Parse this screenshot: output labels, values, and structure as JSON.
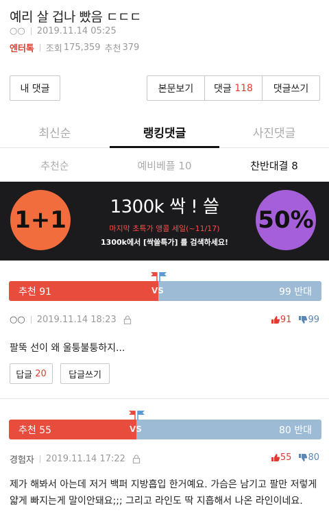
{
  "post": {
    "title": "예리 살 겁나 빴음 ㄷㄷㄷ",
    "author": "○○",
    "datetime": "2019.11.14 05:25",
    "category": "엔터톡",
    "views_label": "조회",
    "views": "175,359",
    "recommend_label": "추천",
    "recommend": "379"
  },
  "buttons": {
    "my_comments": "내 댓글",
    "view_body": "본문보기",
    "comments_label": "댓글",
    "comments_count": "118",
    "write_comment": "댓글쓰기"
  },
  "tabs": [
    {
      "label": "최신순"
    },
    {
      "label": "랭킹댓글"
    },
    {
      "label": "사진댓글"
    }
  ],
  "subtabs": [
    {
      "label": "추천순"
    },
    {
      "label": "예비베플 10"
    },
    {
      "label": "찬반대결 8"
    }
  ],
  "ad": {
    "left_badge": "1+1",
    "headline": "1300k 싹 ! 쓸",
    "sub1": "마지막 초특가 앵콜 세일(~11/17)",
    "sub2": "1300k에서 [싹쓸특가] 를 검색하세요!",
    "right_badge": "50%"
  },
  "comments": [
    {
      "vote_up_text": "추천 91",
      "vote_down_text": "99 반대",
      "vs": "VS",
      "up_ratio": 0.479,
      "author": "○○",
      "datetime": "2019.11.14 18:23",
      "likes": "91",
      "dislikes": "99",
      "body": "팔뚝 선이 왜 울퉁불퉁하지...",
      "reply_label": "답글",
      "reply_count": "20",
      "reply_write": "답글쓰기"
    },
    {
      "vote_up_text": "추천 55",
      "vote_down_text": "80 반대",
      "vs": "VS",
      "up_ratio": 0.407,
      "author": "경험자",
      "datetime": "2019.11.14 17:22",
      "likes": "55",
      "dislikes": "80",
      "body": "제가 해봐서 아는데 저거 백퍼 지방흡입 한거예요. 가슴은 남기고 팔만 저렇게 얇게 빠지는게 말이안돼요;;; 그리고 라인도 딱 지흡해서 나온 라인이네요."
    }
  ],
  "colors": {
    "accent_red": "#e03c31",
    "vote_up": "#e84c3d",
    "vote_down": "#9ebbd5",
    "ad_bg": "#1b1b1d"
  }
}
